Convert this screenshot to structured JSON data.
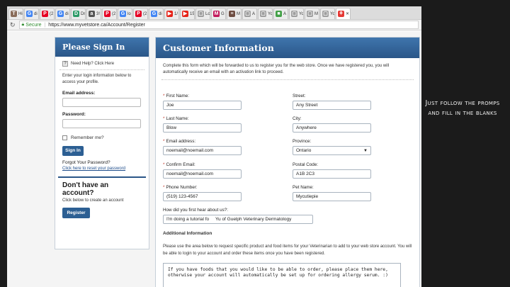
{
  "browser": {
    "tabs": [
      {
        "icon": "T",
        "color": "#8a6d5a",
        "label": "Hi"
      },
      {
        "icon": "G",
        "color": "#4285f4",
        "label": "di"
      },
      {
        "icon": "P",
        "color": "#e60023",
        "label": "(2"
      },
      {
        "icon": "G",
        "color": "#4285f4",
        "label": "di"
      },
      {
        "icon": "D",
        "color": "#2b9a66",
        "label": "Dr"
      },
      {
        "icon": "a",
        "color": "#555555",
        "label": "3!"
      },
      {
        "icon": "P",
        "color": "#e60023",
        "label": "(2"
      },
      {
        "icon": "G",
        "color": "#4285f4",
        "label": "lo"
      },
      {
        "icon": "P",
        "color": "#e60023",
        "label": "(2"
      },
      {
        "icon": "G",
        "color": "#4285f4",
        "label": "di"
      },
      {
        "icon": "▶",
        "color": "#e62117",
        "label": "1/"
      },
      {
        "icon": "▶",
        "color": "#e62117",
        "label": "15"
      },
      {
        "icon": "▢",
        "color": "#9e9e9e",
        "label": "Lo"
      },
      {
        "icon": "M",
        "color": "#c2185b",
        "label": "G"
      },
      {
        "icon": "≡",
        "color": "#6d4c41",
        "label": "M"
      },
      {
        "icon": "▢",
        "color": "#9e9e9e",
        "label": "A"
      },
      {
        "icon": "▢",
        "color": "#9e9e9e",
        "label": "Yo"
      },
      {
        "icon": "■",
        "color": "#43a047",
        "label": "A"
      },
      {
        "icon": "▢",
        "color": "#9e9e9e",
        "label": "Yo"
      },
      {
        "icon": "▢",
        "color": "#9e9e9e",
        "label": "M"
      },
      {
        "icon": "▢",
        "color": "#9e9e9e",
        "label": "Yo"
      },
      {
        "icon": "⚘",
        "color": "#e53935",
        "label": "✕",
        "active": true
      }
    ],
    "secure_label": "Secure",
    "url": "https://www.myvetstore.ca/Account/Register"
  },
  "signin": {
    "title": "Please Sign In",
    "help": "Need Help? Click Here",
    "instructions": "Enter your login information below to access your profile.",
    "email_label": "Email address:",
    "password_label": "Password:",
    "remember_label": "Remember me?",
    "signin_button": "Sign In",
    "forgot_title": "Forgot Your Password?",
    "forgot_link": "Click here to reset your password",
    "noacct_title": "Don't have an account?",
    "noacct_sub": "Click below to create an account",
    "register_button": "Register"
  },
  "customer": {
    "title": "Customer Information",
    "intro": "Complete this form which will be forwarded to us to register you for the web store. Once we have registered you, you will automatically receive an email with an activation link to proceed.",
    "required_mark": "*",
    "fields": {
      "first_name": {
        "label": "First Name:",
        "value": "Joe"
      },
      "last_name": {
        "label": "Last Name:",
        "value": "Blow"
      },
      "email": {
        "label": "Email address:",
        "value": "noemail@noemail.com"
      },
      "confirm_email": {
        "label": "Confirm Email:",
        "value": "noemail@noemail.com"
      },
      "phone": {
        "label": "Phone Number:",
        "value": "(519) 123-4567"
      },
      "street": {
        "label": "Street:",
        "value": "Any Street"
      },
      "city": {
        "label": "City:",
        "value": "Anywhere"
      },
      "province": {
        "label": "Province:",
        "value": "Ontario"
      },
      "postal": {
        "label": "Postal Code:",
        "value": "A1B 2C3"
      },
      "pet_name": {
        "label": "Pet Name:",
        "value": "Mycutiepie"
      },
      "heard": {
        "label": "How did you first hear about us?:",
        "value": "I'm doing a tutorial fo     Yu of Guelph Veterinary Dermatology"
      }
    },
    "additional_title": "Additional Information",
    "additional_text": "Please use the area below to request specific product and food items for your Veterinarian to add to your web store account. You will be able to login to your account and order these items once you have been registered.",
    "notes": "If you have foods that you would like to be able to order, please place them here,\notherwise your account will automatically be set up for ordering allergy serum. :)"
  },
  "caption": "Just follow the promps and fill in the blanks"
}
